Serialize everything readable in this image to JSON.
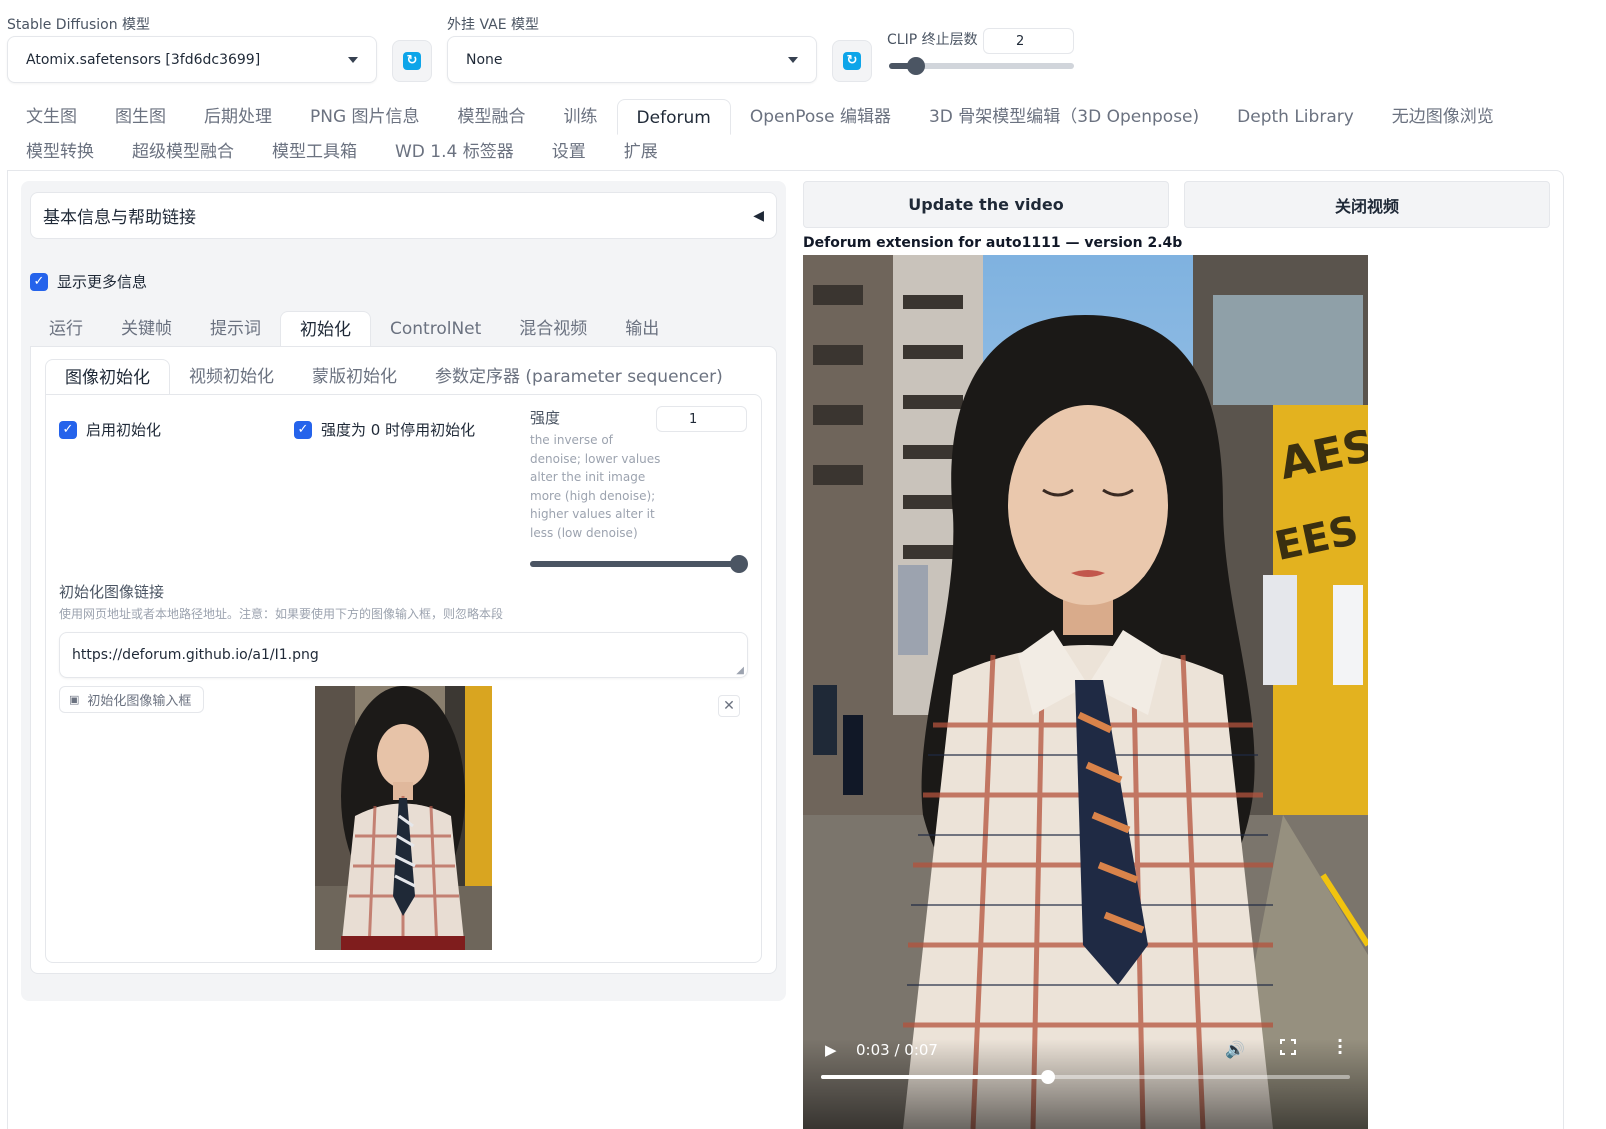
{
  "top": {
    "sd_model_label": "Stable Diffusion 模型",
    "sd_model_value": "Atomix.safetensors [3fd6dc3699]",
    "vae_label": "外挂 VAE 模型",
    "vae_value": "None",
    "clip_label": "CLIP 终止层数",
    "clip_value": "2",
    "clip_min": 1,
    "clip_max": 12
  },
  "main_tabs_row1": [
    "文生图",
    "图生图",
    "后期处理",
    "PNG 图片信息",
    "模型融合",
    "训练",
    "Deforum",
    "OpenPose 编辑器",
    "3D 骨架模型编辑（3D Openpose)",
    "Depth Library",
    "无边图像浏览"
  ],
  "main_tabs_row2": [
    "模型转换",
    "超级模型融合",
    "模型工具箱",
    "WD 1.4 标签器",
    "设置",
    "扩展"
  ],
  "active_main_tab": "Deforum",
  "accordion_title": "基本信息与帮助链接",
  "show_more_info": "显示更多信息",
  "sub_tabs": [
    "运行",
    "关键帧",
    "提示词",
    "初始化",
    "ControlNet",
    "混合视频",
    "输出"
  ],
  "init_tabs": [
    "图像初始化",
    "视频初始化",
    "蒙版初始化",
    "参数定序器 (parameter sequencer)"
  ],
  "init": {
    "enable_init_label": "启用初始化",
    "strength_zero_label": "强度为 0 时停用初始化",
    "strength_label": "强度",
    "strength_value": "1",
    "strength_desc": "the inverse of denoise; lower values alter the init image more (high denoise); higher values alter it less (low denoise)",
    "strength_fraction": 1.0,
    "image_link_label": "初始化图像链接",
    "image_link_hint": "使用网页地址或者本地路径地址。注意：如果要使用下方的图像输入框，则忽略本段",
    "image_link_value": "https://deforum.github.io/a1/I1.png",
    "image_box_label": "初始化图像输入框"
  },
  "right": {
    "update_video": "Update the video",
    "close_video": "关闭视频",
    "version_text": "Deforum extension for auto1111 — version 2.4b",
    "video_time": "0:03 / 0:07",
    "video_progress": 0.43
  }
}
